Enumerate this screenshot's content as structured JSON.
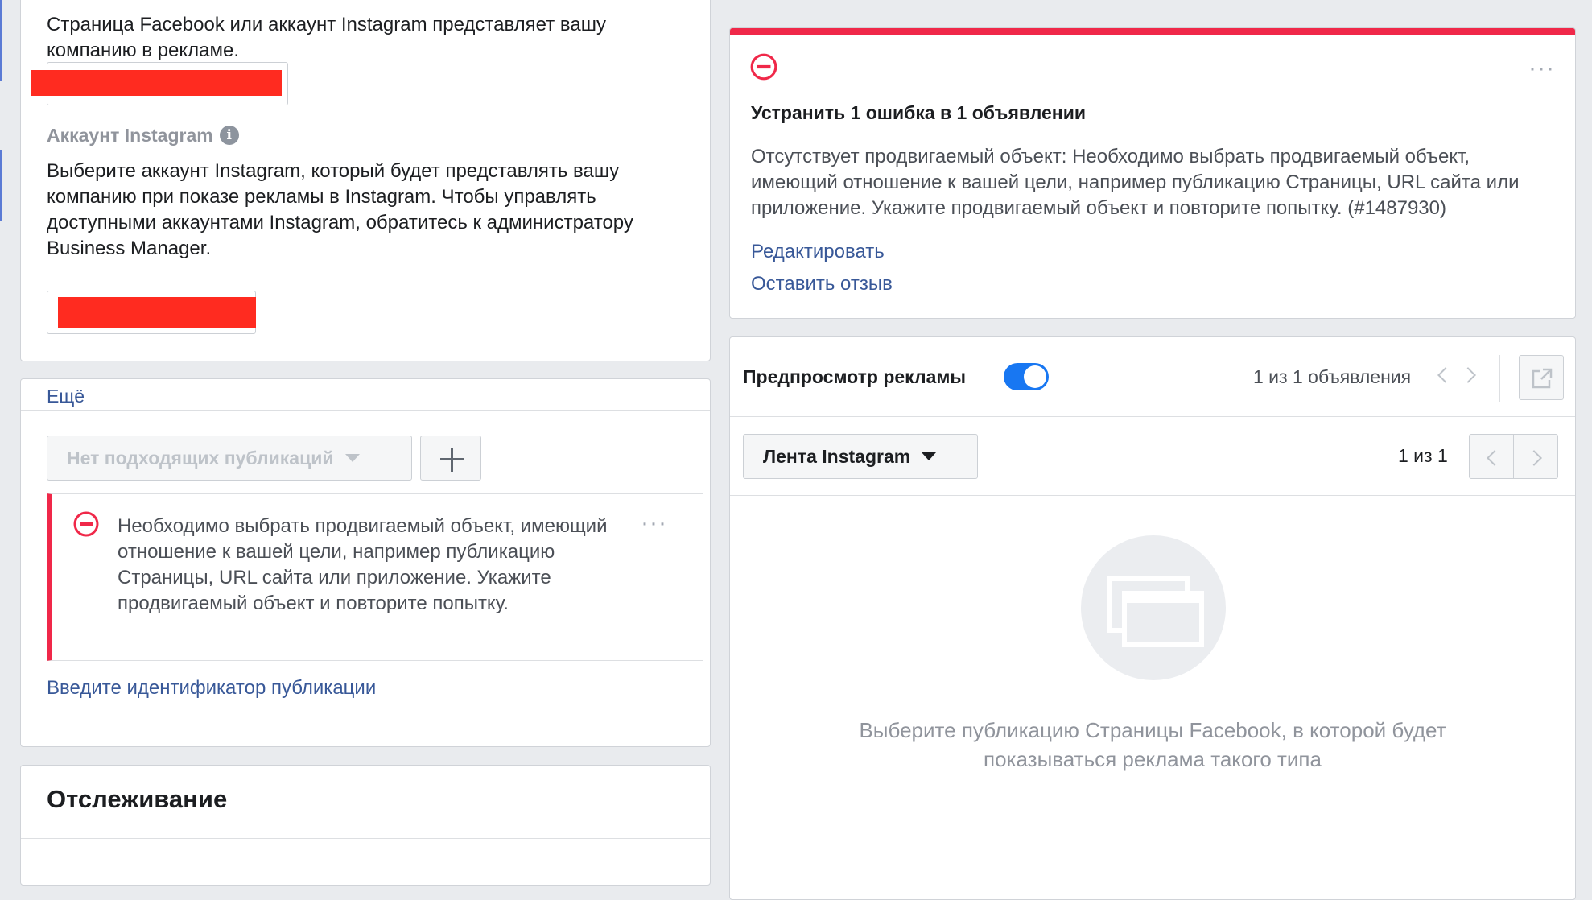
{
  "left": {
    "page_desc": "Страница Facebook или аккаунт Instagram представляет вашу компанию в рекламе.",
    "instagram_label": "Аккаунт Instagram",
    "instagram_desc": "Выберите аккаунт Instagram, который будет представлять вашу компанию при показе рекламы в Instagram. Чтобы управлять доступными аккаунтами Instagram, обратитесь к администратору Business Manager.",
    "more_link": "Ещё",
    "no_posts_dropdown": "Нет подходящих публикаций",
    "error_text": "Необходимо выбрать продвигаемый объект, имеющий отношение к вашей цели, например публикацию Страницы, URL сайта или приложение. Укажите продвигаемый объект и повторите попытку.",
    "enter_id_link": "Введите идентификатор публикации",
    "tracking_title": "Отслеживание"
  },
  "error_card": {
    "accent_color": "#f02849",
    "title": "Устранить 1 ошибка в 1 объявлении",
    "body": "Отсутствует продвигаемый объект: Необходимо выбрать продвигаемый объект, имеющий отношение к вашей цели, например публикацию Страницы, URL сайта или приложение. Укажите продвигаемый объект и повторите попытку. (#1487930)",
    "edit_link": "Редактировать",
    "feedback_link": "Оставить отзыв"
  },
  "preview": {
    "title": "Предпросмотр рекламы",
    "toggle_on": true,
    "ads_counter": "1 из 1 объявления",
    "placement": "Лента Instagram",
    "placement_counter": "1 из 1",
    "empty_text": "Выберите публикацию Страницы Facebook, в которой будет показываться реклама такого типа",
    "toggle_color": "#1877f2"
  }
}
